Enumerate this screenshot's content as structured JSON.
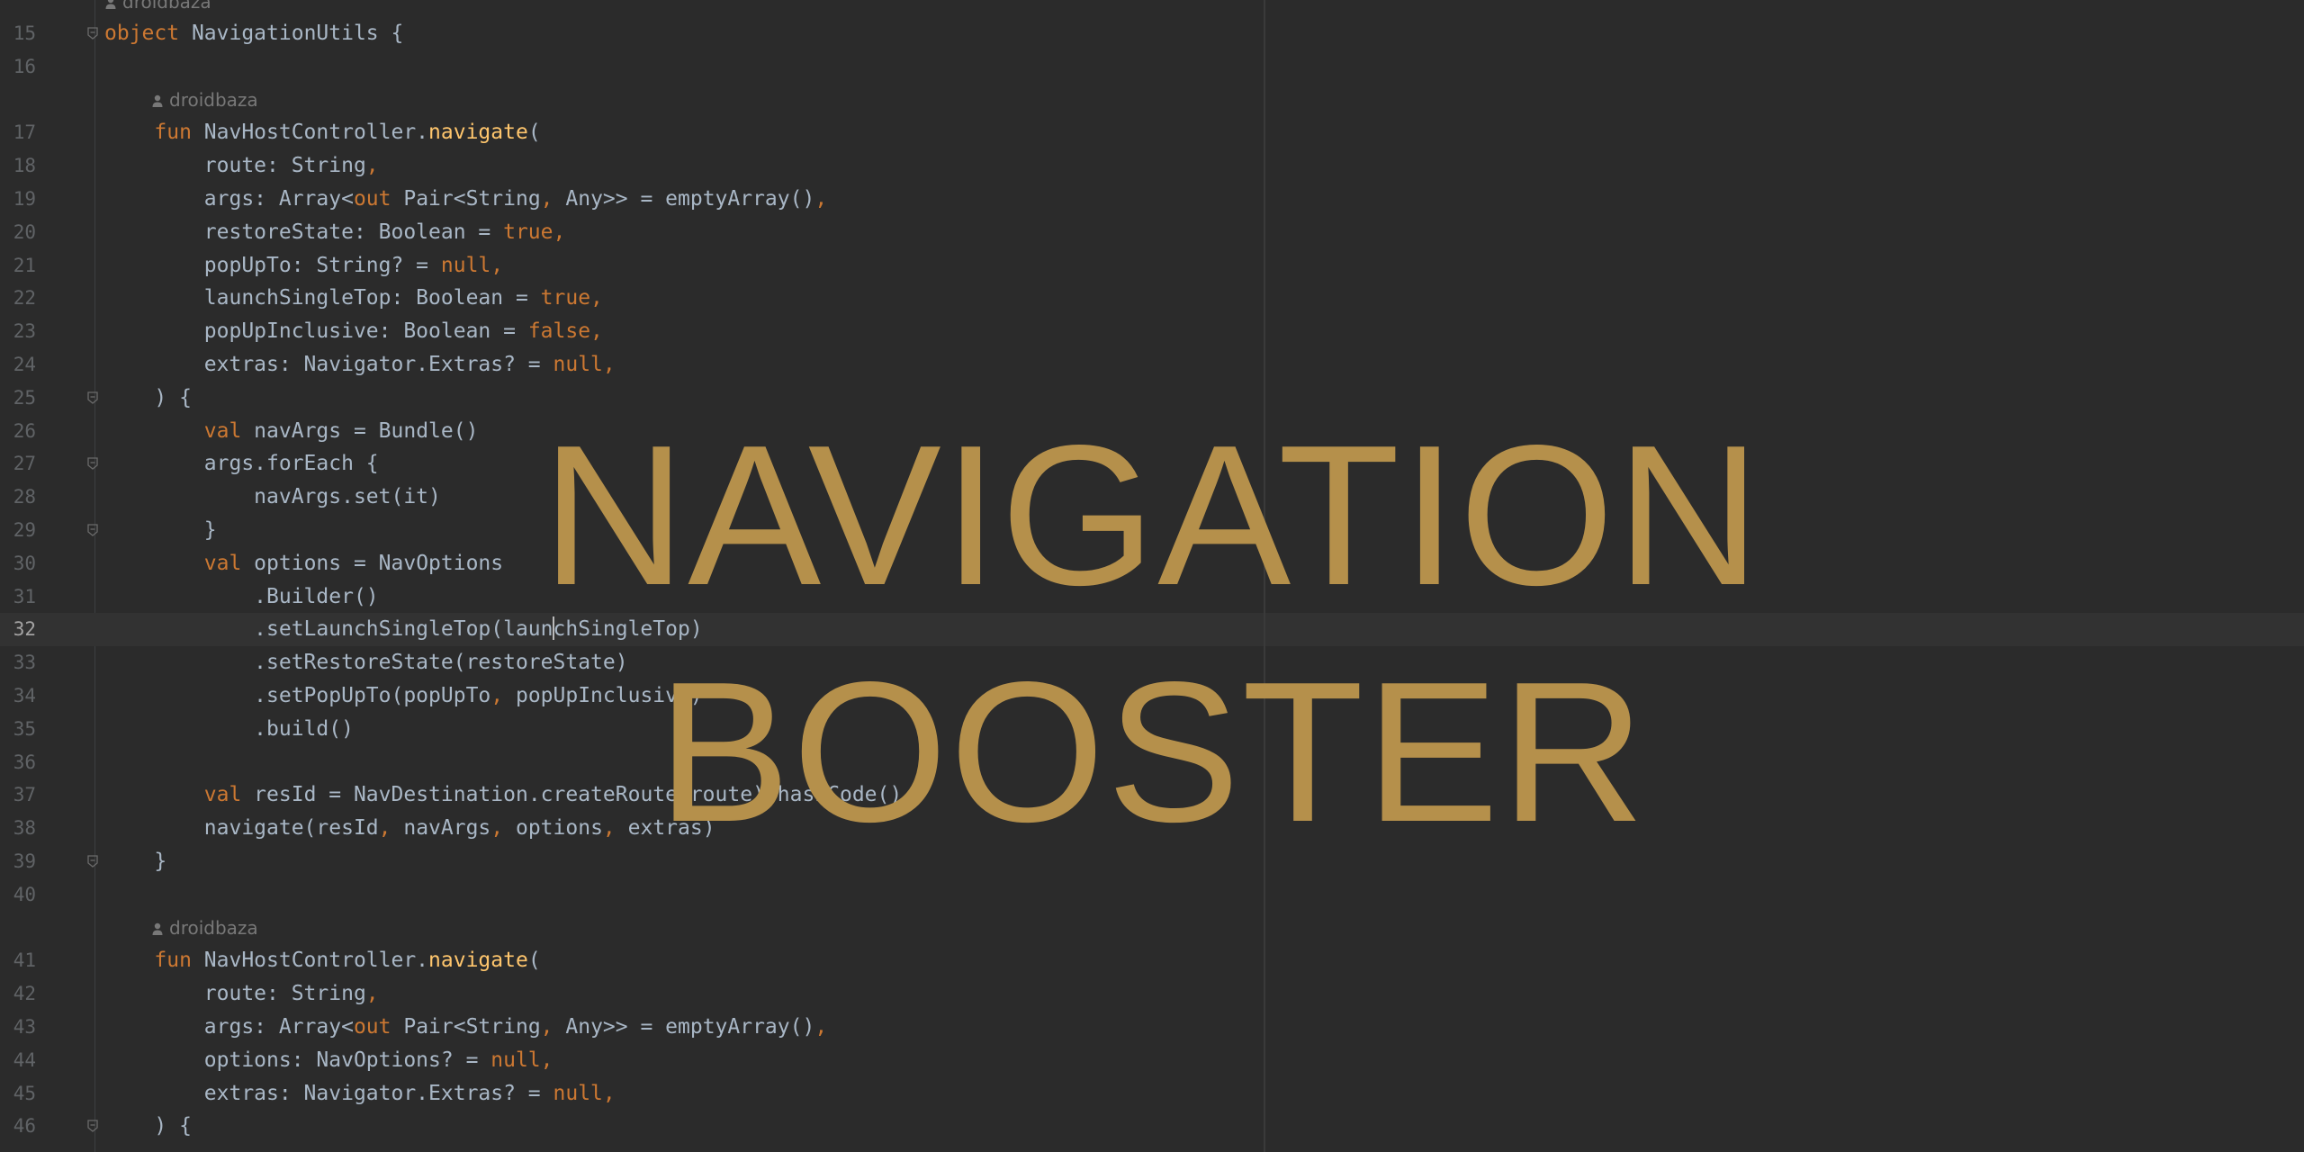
{
  "editor": {
    "author": "droidbaza",
    "lines": [
      {
        "num": "15",
        "parts": [
          {
            "t": "object",
            "c": "kw"
          },
          {
            "t": " NavigationUtils {"
          }
        ]
      },
      {
        "num": "16",
        "parts": []
      },
      {
        "num": "17",
        "parts": [
          {
            "t": "    "
          },
          {
            "t": "fun",
            "c": "kw"
          },
          {
            "t": " NavHostController."
          },
          {
            "t": "navigate",
            "c": "fn"
          },
          {
            "t": "("
          }
        ]
      },
      {
        "num": "18",
        "parts": [
          {
            "t": "        route: String"
          },
          {
            "t": ",",
            "c": "kw"
          }
        ]
      },
      {
        "num": "19",
        "parts": [
          {
            "t": "        args: Array<"
          },
          {
            "t": "out",
            "c": "kw"
          },
          {
            "t": " Pair<String"
          },
          {
            "t": ",",
            "c": "kw"
          },
          {
            "t": " Any>> = emptyArray()"
          },
          {
            "t": ",",
            "c": "kw"
          }
        ]
      },
      {
        "num": "20",
        "parts": [
          {
            "t": "        restoreState: Boolean = "
          },
          {
            "t": "true,",
            "c": "kw"
          }
        ]
      },
      {
        "num": "21",
        "parts": [
          {
            "t": "        popUpTo: String? = "
          },
          {
            "t": "null,",
            "c": "kw"
          }
        ]
      },
      {
        "num": "22",
        "parts": [
          {
            "t": "        launchSingleTop: Boolean = "
          },
          {
            "t": "true,",
            "c": "kw"
          }
        ]
      },
      {
        "num": "23",
        "parts": [
          {
            "t": "        popUpInclusive: Boolean = "
          },
          {
            "t": "false,",
            "c": "kw"
          }
        ]
      },
      {
        "num": "24",
        "parts": [
          {
            "t": "        extras: Navigator.Extras? = "
          },
          {
            "t": "null,",
            "c": "kw"
          }
        ]
      },
      {
        "num": "25",
        "parts": [
          {
            "t": "    ) {"
          }
        ]
      },
      {
        "num": "26",
        "parts": [
          {
            "t": "        "
          },
          {
            "t": "val",
            "c": "kw"
          },
          {
            "t": " navArgs = Bundle()"
          }
        ]
      },
      {
        "num": "27",
        "parts": [
          {
            "t": "        args.forEach {"
          }
        ]
      },
      {
        "num": "28",
        "parts": [
          {
            "t": "            navArgs.set(it)"
          }
        ]
      },
      {
        "num": "29",
        "parts": [
          {
            "t": "        }"
          }
        ]
      },
      {
        "num": "30",
        "parts": [
          {
            "t": "        "
          },
          {
            "t": "val",
            "c": "kw"
          },
          {
            "t": " options = NavOptions"
          }
        ]
      },
      {
        "num": "31",
        "parts": [
          {
            "t": "            .Builder()"
          }
        ]
      },
      {
        "num": "32",
        "parts": [
          {
            "t": "            .setLaunchSingleTop(laun"
          },
          {
            "t": "",
            "c": "caret"
          },
          {
            "t": "chSingleTop)"
          }
        ]
      },
      {
        "num": "33",
        "parts": [
          {
            "t": "            .setRestoreState(restoreState)"
          }
        ]
      },
      {
        "num": "34",
        "parts": [
          {
            "t": "            .setPopUpTo(popUpTo"
          },
          {
            "t": ",",
            "c": "kw"
          },
          {
            "t": " popUpInclusive)"
          }
        ]
      },
      {
        "num": "35",
        "parts": [
          {
            "t": "            .build()"
          }
        ]
      },
      {
        "num": "36",
        "parts": []
      },
      {
        "num": "37",
        "parts": [
          {
            "t": "        "
          },
          {
            "t": "val",
            "c": "kw"
          },
          {
            "t": " resId = NavDestination.createRoute(route).hashCode()"
          }
        ]
      },
      {
        "num": "38",
        "parts": [
          {
            "t": "        navigate(resId"
          },
          {
            "t": ",",
            "c": "kw"
          },
          {
            "t": " navArgs"
          },
          {
            "t": ",",
            "c": "kw"
          },
          {
            "t": " options"
          },
          {
            "t": ",",
            "c": "kw"
          },
          {
            "t": " extras)"
          }
        ]
      },
      {
        "num": "39",
        "parts": [
          {
            "t": "    }"
          }
        ]
      },
      {
        "num": "40",
        "parts": []
      },
      {
        "num": "41",
        "parts": [
          {
            "t": "    "
          },
          {
            "t": "fun",
            "c": "kw"
          },
          {
            "t": " NavHostController."
          },
          {
            "t": "navigate",
            "c": "fn"
          },
          {
            "t": "("
          }
        ]
      },
      {
        "num": "42",
        "parts": [
          {
            "t": "        route: String"
          },
          {
            "t": ",",
            "c": "kw"
          }
        ]
      },
      {
        "num": "43",
        "parts": [
          {
            "t": "        args: Array<"
          },
          {
            "t": "out",
            "c": "kw"
          },
          {
            "t": " Pair<String"
          },
          {
            "t": ",",
            "c": "kw"
          },
          {
            "t": " Any>> = emptyArray()"
          },
          {
            "t": ",",
            "c": "kw"
          }
        ]
      },
      {
        "num": "44",
        "parts": [
          {
            "t": "        options: NavOptions? = "
          },
          {
            "t": "null,",
            "c": "kw"
          }
        ]
      },
      {
        "num": "45",
        "parts": [
          {
            "t": "        extras: Navigator.Extras? = "
          },
          {
            "t": "null,",
            "c": "kw"
          }
        ]
      },
      {
        "num": "46",
        "parts": [
          {
            "t": "    ) {"
          }
        ]
      }
    ],
    "current_line": "32",
    "folds": [
      "15",
      "25",
      "27",
      "29",
      "39",
      "46"
    ]
  },
  "overlay": {
    "line1": "NAVIGATION",
    "line2": "BOOSTER"
  },
  "colors": {
    "background": "#2b2b2b",
    "keyword": "#cc7832",
    "function": "#ffc66d",
    "text": "#a9b7c6",
    "overlay": "#b5904b"
  }
}
